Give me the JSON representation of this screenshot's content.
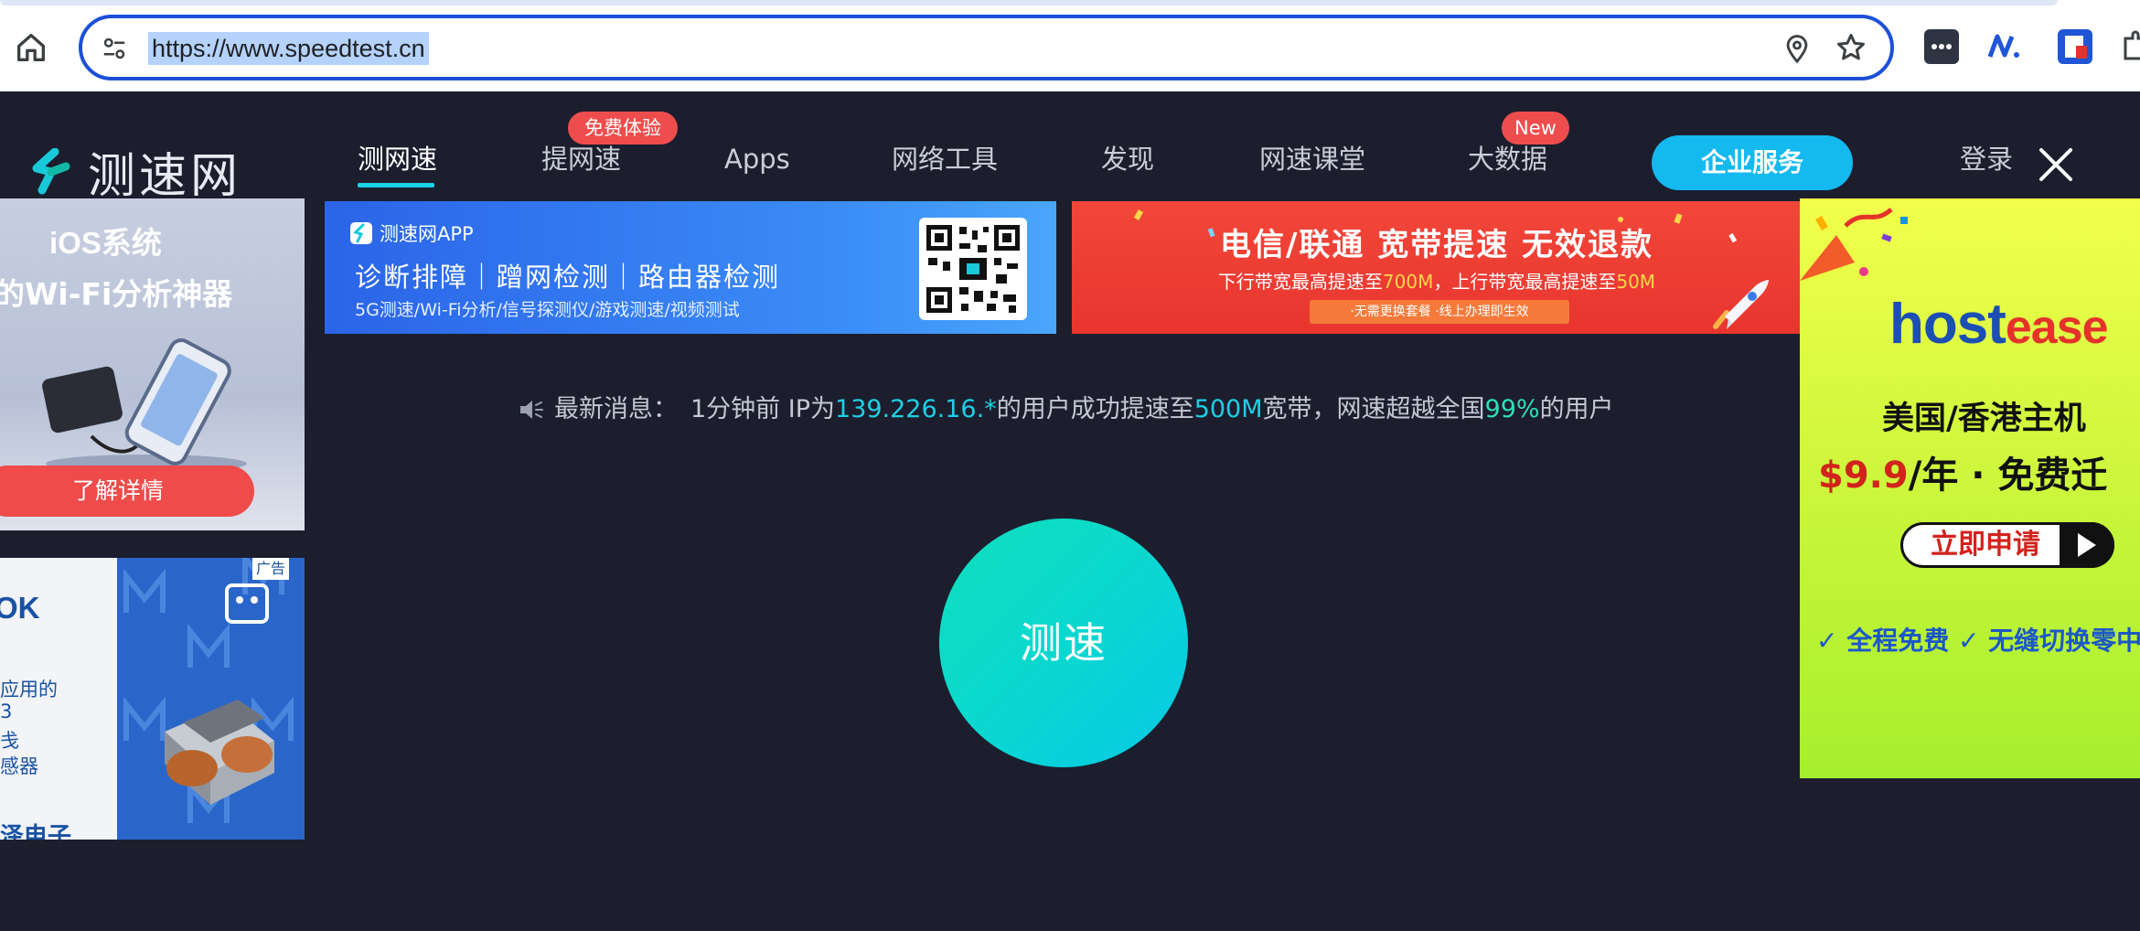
{
  "browser": {
    "url": "https://www.speedtest.cn",
    "icons": [
      "home-icon",
      "site-settings-icon",
      "location-pin-icon",
      "bookmark-star-icon"
    ],
    "extensions": [
      "password-manager-icon",
      "notion-icon",
      "reader-icon",
      "extension-icon"
    ]
  },
  "header": {
    "logo_text": "测速网",
    "nav": [
      {
        "label": "测网速"
      },
      {
        "label": "提网速",
        "badge": "免费体验"
      },
      {
        "label": "Apps"
      },
      {
        "label": "网络工具"
      },
      {
        "label": "发现"
      },
      {
        "label": "网速课堂"
      },
      {
        "label": "大数据",
        "badge": "New"
      }
    ],
    "enterprise_label": "企业服务",
    "login_label": "登录",
    "accent_color": "#18d2e8",
    "badge_color": "#ef4d4d"
  },
  "ads": {
    "left_top": {
      "title1": "iOS系统",
      "title2": "的Wi-Fi分析神器",
      "cta": "了解详情"
    },
    "left_bottom": {
      "headline": "OK",
      "lines": [
        "应用的",
        "3",
        "戋",
        "感器",
        "泽电子"
      ],
      "tag": "广告"
    },
    "banner1": {
      "app_name": "测速网APP",
      "main": "诊断排障｜蹭网检测｜路由器检测",
      "sub": "5G测速/Wi-Fi分析/信号探测仪/游戏测速/视频测试"
    },
    "banner2": {
      "headline": "电信/联通  宽带提速  无效退款",
      "sub_prefix": "下行带宽最高提速至",
      "sub_down": "700M",
      "sub_mid": "，上行带宽最高提速至",
      "sub_up": "50M",
      "pill": "·无需更换套餐   ·线上办理即生效"
    },
    "right": {
      "brand_a": "host",
      "brand_b": "ease",
      "line1": "美国/香港主机",
      "price": "$9.9",
      "price_tail": "/年 · 免费迁",
      "button": "立即申请",
      "features": "✓ 全程免费 ✓ 无缝切换零中"
    }
  },
  "news": {
    "label": "最新消息：",
    "time": "1分钟前 IP为",
    "ip": "139.226.16.*",
    "mid": "的用户成功提速至",
    "speed": "500M",
    "mid2": "宽带，网速超越全国",
    "percent": "99%",
    "tail": "的用户"
  },
  "test_button": {
    "label": "测速",
    "color_from": "#0ee0bc",
    "color_to": "#06c8e6"
  }
}
